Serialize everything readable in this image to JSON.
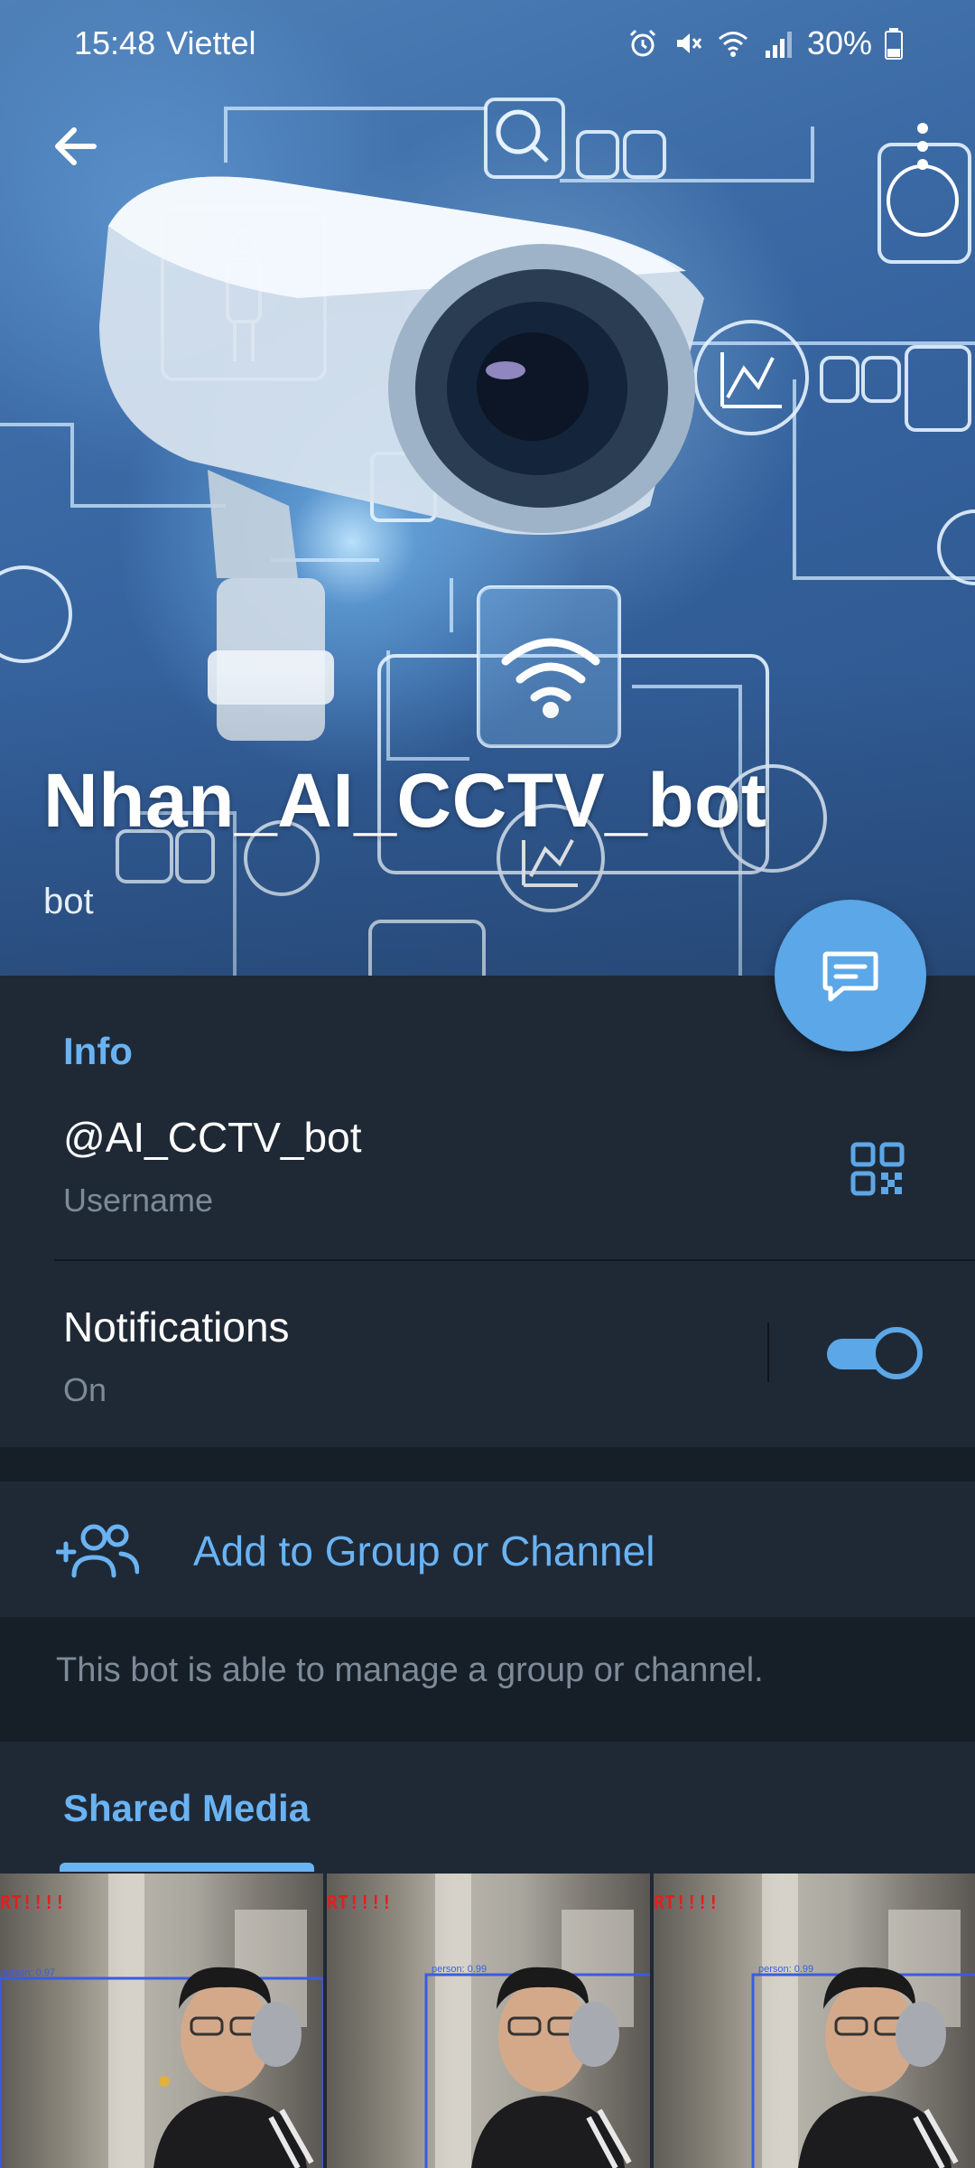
{
  "status_bar": {
    "time": "15:48",
    "carrier": "Viettel",
    "battery": "30%",
    "icons": [
      "alarm-icon",
      "mute-icon",
      "wifi-icon",
      "signal-icon",
      "battery-icon"
    ]
  },
  "header": {
    "bot_name": "Nhan_AI_CCTV_bot",
    "subtitle": "bot",
    "back_icon": "arrow-left-icon",
    "menu_icon": "more-vertical-icon",
    "fab_icon": "message-icon"
  },
  "info": {
    "section_title": "Info",
    "username": "@AI_CCTV_bot",
    "username_label": "Username",
    "qr_icon": "qr-code-icon",
    "notifications_title": "Notifications",
    "notifications_status": "On",
    "notifications_enabled": true
  },
  "actions": {
    "add_label": "Add to Group or Channel",
    "add_icon": "add-users-icon",
    "hint": "This bot is able to manage a group or channel."
  },
  "media": {
    "section_title": "Shared Media",
    "thumbnails": [
      {
        "alert": "RT!!!!",
        "label": "person: 0.97"
      },
      {
        "alert": "RT!!!!",
        "label": "person: 0.99"
      },
      {
        "alert": "RT!!!!",
        "label": "person: 0.99"
      }
    ]
  },
  "colors": {
    "background": "#1d2733",
    "panel": "#1f2936",
    "accent": "#6ab3f3",
    "fab": "#5ba7e7",
    "muted_text": "#7d8b99"
  }
}
